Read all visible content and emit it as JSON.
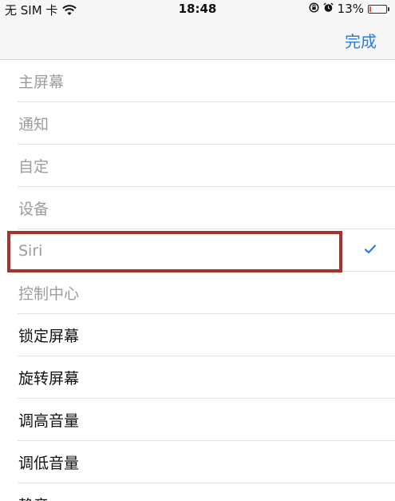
{
  "status_bar": {
    "carrier": "无 SIM 卡",
    "time": "18:48",
    "battery_percent": "13%",
    "battery_level": 0.13,
    "battery_color": "#e24b4b"
  },
  "nav": {
    "done_label": "完成",
    "accent_color": "#2f7ad8"
  },
  "list": {
    "items": [
      {
        "label": "主屏幕",
        "state": "disabled"
      },
      {
        "label": "通知",
        "state": "disabled"
      },
      {
        "label": "自定",
        "state": "disabled"
      },
      {
        "label": "设备",
        "state": "disabled"
      },
      {
        "label": "Siri",
        "state": "disabled",
        "checked": true,
        "highlighted": true
      },
      {
        "label": "控制中心",
        "state": "disabled"
      },
      {
        "label": "锁定屏幕",
        "state": "enabled"
      },
      {
        "label": "旋转屏幕",
        "state": "enabled"
      },
      {
        "label": "调高音量",
        "state": "enabled"
      },
      {
        "label": "调低音量",
        "state": "enabled"
      },
      {
        "label": "静音",
        "state": "enabled"
      }
    ]
  },
  "highlight_color": "#a8322d"
}
